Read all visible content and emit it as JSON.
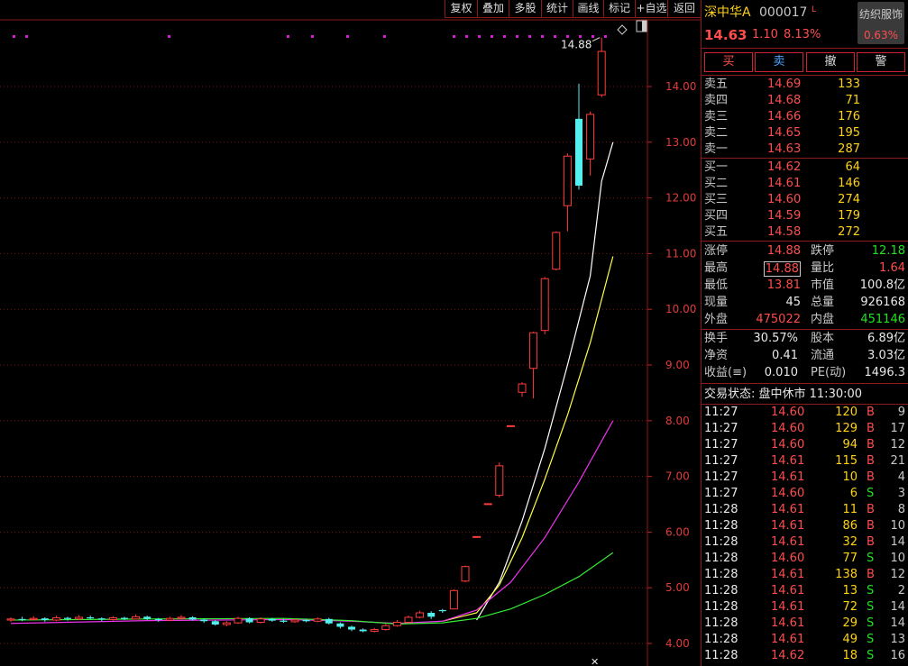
{
  "toolbar": [
    "复权",
    "叠加",
    "多股",
    "统计",
    "画线",
    "标记",
    "+自选",
    "返回"
  ],
  "stock": {
    "name": "深中华A",
    "code": "000017",
    "flag": "L",
    "price": "14.63",
    "change": "1.10",
    "pct": "8.13%",
    "sector": "纺织服饰",
    "sector_pct": "0.63%"
  },
  "actions": [
    "买",
    "卖",
    "撤",
    "警"
  ],
  "asks": [
    {
      "label": "卖五",
      "price": "14.69",
      "vol": "133"
    },
    {
      "label": "卖四",
      "price": "14.68",
      "vol": "71"
    },
    {
      "label": "卖三",
      "price": "14.66",
      "vol": "176"
    },
    {
      "label": "卖二",
      "price": "14.65",
      "vol": "195"
    },
    {
      "label": "卖一",
      "price": "14.63",
      "vol": "287"
    }
  ],
  "bids": [
    {
      "label": "买一",
      "price": "14.62",
      "vol": "64"
    },
    {
      "label": "买二",
      "price": "14.61",
      "vol": "146"
    },
    {
      "label": "买三",
      "price": "14.60",
      "vol": "274"
    },
    {
      "label": "买四",
      "price": "14.59",
      "vol": "179"
    },
    {
      "label": "买五",
      "price": "14.58",
      "vol": "272"
    }
  ],
  "stats": [
    {
      "l1": "涨停",
      "v1": "14.88",
      "c1": "red",
      "l2": "跌停",
      "v2": "12.18",
      "c2": "green"
    },
    {
      "l1": "最高",
      "v1": "14.88",
      "c1": "red",
      "l2": "量比",
      "v2": "1.64",
      "c2": "red"
    },
    {
      "l1": "最低",
      "v1": "13.81",
      "c1": "red",
      "l2": "市值",
      "v2": "100.8亿",
      "c2": "white"
    },
    {
      "l1": "现量",
      "v1": "45",
      "c1": "white",
      "l2": "总量",
      "v2": "926168",
      "c2": "white"
    },
    {
      "l1": "外盘",
      "v1": "475022",
      "c1": "red",
      "l2": "内盘",
      "v2": "451146",
      "c2": "green"
    }
  ],
  "stats2": [
    {
      "l1": "换手",
      "v1": "30.57%",
      "l2": "股本",
      "v2": "6.89亿"
    },
    {
      "l1": "净资",
      "v1": "0.41",
      "l2": "流通",
      "v2": "3.03亿"
    },
    {
      "l1": "收益(≡)",
      "v1": "0.010",
      "l2": "PE(动)",
      "v2": "1496.3"
    }
  ],
  "trade_status": "交易状态: 盘中休市 11:30:00",
  "ticks": [
    [
      "11:27",
      "14.60",
      "120",
      "B",
      "9"
    ],
    [
      "11:27",
      "14.60",
      "129",
      "B",
      "17"
    ],
    [
      "11:27",
      "14.60",
      "94",
      "B",
      "12"
    ],
    [
      "11:27",
      "14.61",
      "115",
      "B",
      "21"
    ],
    [
      "11:27",
      "14.61",
      "10",
      "B",
      "4"
    ],
    [
      "11:27",
      "14.60",
      "6",
      "S",
      "3"
    ],
    [
      "11:28",
      "14.61",
      "11",
      "B",
      "8"
    ],
    [
      "11:28",
      "14.61",
      "86",
      "B",
      "10"
    ],
    [
      "11:28",
      "14.61",
      "32",
      "B",
      "14"
    ],
    [
      "11:28",
      "14.60",
      "77",
      "S",
      "10"
    ],
    [
      "11:28",
      "14.61",
      "138",
      "B",
      "12"
    ],
    [
      "11:28",
      "14.61",
      "13",
      "S",
      "2"
    ],
    [
      "11:28",
      "14.61",
      "72",
      "S",
      "14"
    ],
    [
      "11:28",
      "14.61",
      "29",
      "S",
      "14"
    ],
    [
      "11:28",
      "14.61",
      "49",
      "S",
      "13"
    ],
    [
      "11:28",
      "14.62",
      "18",
      "S",
      "16"
    ]
  ],
  "chart_data": {
    "type": "candlestick",
    "high_label": "14.88",
    "y_ticks": [
      "14.00",
      "13.00",
      "12.00",
      "11.00",
      "10.00",
      "9.00",
      "8.00",
      "7.00",
      "6.00",
      "5.00",
      "4.00"
    ],
    "ylim": [
      3.6,
      15.5
    ],
    "candles": [
      [
        4.42,
        4.44,
        4.47,
        4.39
      ],
      [
        4.44,
        4.43,
        4.48,
        4.4
      ],
      [
        4.43,
        4.45,
        4.49,
        4.41
      ],
      [
        4.45,
        4.42,
        4.47,
        4.39
      ],
      [
        4.42,
        4.46,
        4.5,
        4.4
      ],
      [
        4.46,
        4.44,
        4.48,
        4.41
      ],
      [
        4.44,
        4.47,
        4.51,
        4.42
      ],
      [
        4.47,
        4.45,
        4.5,
        4.43
      ],
      [
        4.45,
        4.43,
        4.47,
        4.4
      ],
      [
        4.43,
        4.46,
        4.49,
        4.41
      ],
      [
        4.46,
        4.44,
        4.48,
        4.42
      ],
      [
        4.44,
        4.48,
        4.52,
        4.43
      ],
      [
        4.48,
        4.44,
        4.5,
        4.42
      ],
      [
        4.44,
        4.42,
        4.46,
        4.39
      ],
      [
        4.42,
        4.45,
        4.48,
        4.4
      ],
      [
        4.45,
        4.47,
        4.51,
        4.43
      ],
      [
        4.47,
        4.43,
        4.49,
        4.41
      ],
      [
        4.43,
        4.4,
        4.45,
        4.37
      ],
      [
        4.4,
        4.34,
        4.42,
        4.32
      ],
      [
        4.34,
        4.37,
        4.4,
        4.31
      ],
      [
        4.37,
        4.45,
        4.48,
        4.35
      ],
      [
        4.45,
        4.38,
        4.47,
        4.36
      ],
      [
        4.38,
        4.44,
        4.47,
        4.36
      ],
      [
        4.44,
        4.41,
        4.46,
        4.39
      ],
      [
        4.41,
        4.39,
        4.44,
        4.37
      ],
      [
        4.39,
        4.42,
        4.45,
        4.37
      ],
      [
        4.42,
        4.4,
        4.44,
        4.38
      ],
      [
        4.4,
        4.44,
        4.47,
        4.38
      ],
      [
        4.44,
        4.36,
        4.46,
        4.34
      ],
      [
        4.36,
        4.3,
        4.38,
        4.27
      ],
      [
        4.3,
        4.25,
        4.32,
        4.22
      ],
      [
        4.25,
        4.22,
        4.27,
        4.2
      ],
      [
        4.22,
        4.25,
        4.28,
        4.2
      ],
      [
        4.25,
        4.32,
        4.35,
        4.23
      ],
      [
        4.32,
        4.38,
        4.42,
        4.3
      ],
      [
        4.38,
        4.47,
        4.5,
        4.36
      ],
      [
        4.47,
        4.55,
        4.59,
        4.45
      ],
      [
        4.55,
        4.48,
        4.58,
        4.44
      ],
      [
        4.6,
        4.58,
        4.62,
        4.55
      ],
      [
        4.62,
        4.95,
        4.97,
        4.62
      ],
      [
        5.12,
        5.38,
        5.4,
        5.1
      ],
      [
        5.92,
        5.92,
        5.92,
        5.92
      ],
      [
        6.51,
        6.51,
        6.51,
        6.51
      ],
      [
        6.66,
        7.19,
        7.25,
        6.62
      ],
      [
        7.91,
        7.91,
        7.91,
        7.91
      ],
      [
        8.51,
        8.66,
        8.69,
        8.43
      ],
      [
        8.94,
        9.58,
        9.6,
        8.4
      ],
      [
        9.62,
        10.55,
        10.58,
        9.55
      ],
      [
        10.72,
        11.38,
        11.4,
        10.7
      ],
      [
        11.86,
        12.75,
        12.8,
        11.4
      ],
      [
        13.42,
        12.22,
        14.05,
        12.15
      ],
      [
        12.7,
        13.5,
        13.55,
        12.4
      ],
      [
        13.85,
        14.63,
        14.88,
        13.81
      ]
    ],
    "ma_lines": [
      {
        "color": "#ffffff",
        "points": [
          [
            41,
            4.42
          ],
          [
            43,
            5.1
          ],
          [
            45,
            6.2
          ],
          [
            47,
            7.5
          ],
          [
            49,
            9.0
          ],
          [
            51,
            10.6
          ],
          [
            52,
            12.3
          ],
          [
            53,
            13.0
          ]
        ]
      },
      {
        "color": "#ffff44",
        "points": [
          [
            38,
            4.4
          ],
          [
            41,
            4.55
          ],
          [
            43,
            5.05
          ],
          [
            45,
            5.9
          ],
          [
            47,
            6.95
          ],
          [
            49,
            8.1
          ],
          [
            51,
            9.4
          ],
          [
            53,
            10.95
          ]
        ]
      },
      {
        "color": "#ee33ee",
        "points": [
          [
            34,
            4.36
          ],
          [
            38,
            4.4
          ],
          [
            41,
            4.6
          ],
          [
            44,
            5.1
          ],
          [
            47,
            5.9
          ],
          [
            50,
            6.9
          ],
          [
            53,
            8.0
          ]
        ]
      },
      {
        "color": "#33ee33",
        "points": [
          [
            34,
            4.35
          ],
          [
            38,
            4.37
          ],
          [
            41,
            4.45
          ],
          [
            44,
            4.62
          ],
          [
            47,
            4.88
          ],
          [
            50,
            5.2
          ],
          [
            53,
            5.63
          ]
        ]
      }
    ],
    "ma_base": [
      {
        "color": "#ee33ee",
        "pts": [
          [
            0,
            4.36
          ],
          [
            12,
            4.41
          ],
          [
            24,
            4.43
          ],
          [
            30,
            4.4
          ],
          [
            34,
            4.36
          ]
        ]
      },
      {
        "color": "#33ee33",
        "pts": [
          [
            0,
            4.42
          ],
          [
            12,
            4.44
          ],
          [
            24,
            4.45
          ],
          [
            30,
            4.41
          ],
          [
            34,
            4.35
          ]
        ]
      }
    ]
  }
}
